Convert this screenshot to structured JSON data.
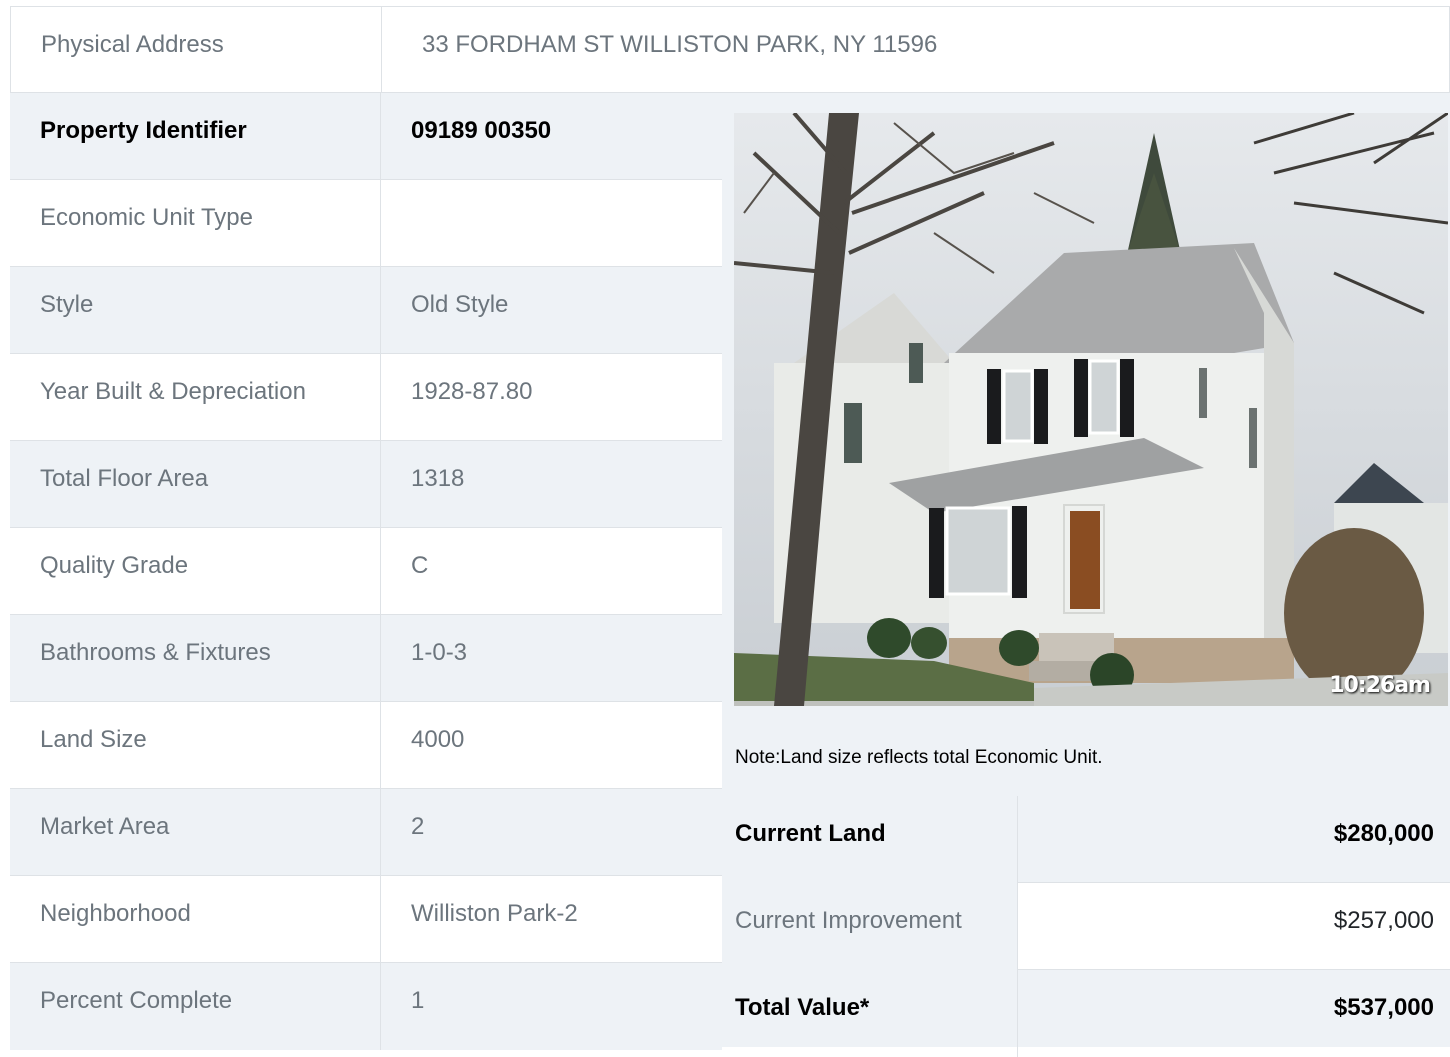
{
  "address": {
    "label": "Physical Address",
    "value": "33  FORDHAM ST  WILLISTON PARK, NY  11596"
  },
  "rows": [
    {
      "label": "Property Identifier",
      "value": "09189  00350"
    },
    {
      "label": "Economic Unit Type",
      "value": ""
    },
    {
      "label": "Style",
      "value": "Old Style"
    },
    {
      "label": "Year Built & Depreciation",
      "value": "1928-87.80"
    },
    {
      "label": "Total Floor Area",
      "value": "1318"
    },
    {
      "label": "Quality Grade",
      "value": "C"
    },
    {
      "label": "Bathrooms & Fixtures",
      "value": "1-0-3"
    },
    {
      "label": "Land Size",
      "value": "4000"
    },
    {
      "label": "Market Area",
      "value": "2"
    },
    {
      "label": "Neighborhood",
      "value": "Williston Park-2"
    },
    {
      "label": "Percent Complete",
      "value": "1"
    }
  ],
  "photo": {
    "timestamp": "10:26am"
  },
  "note": "Note:Land size reflects total Economic Unit.",
  "values": [
    {
      "label": "Current Land",
      "value": "$280,000"
    },
    {
      "label": "Current Improvement",
      "value": "$257,000"
    },
    {
      "label": "Total Value*",
      "value": "$537,000"
    }
  ]
}
